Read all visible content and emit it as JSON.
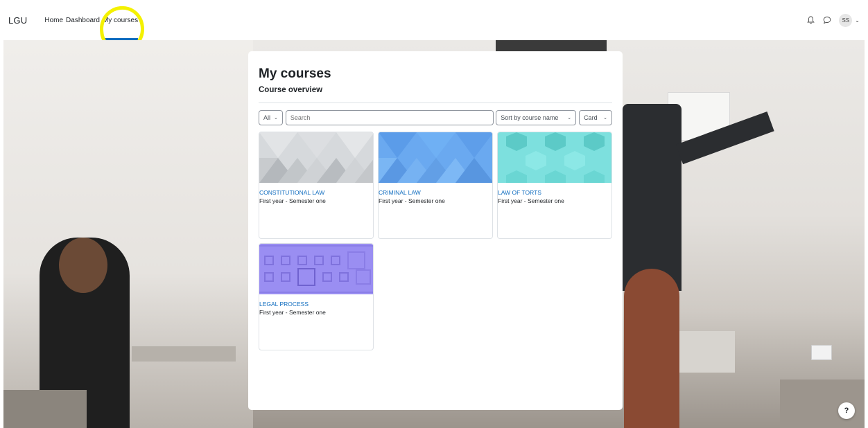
{
  "navbar": {
    "brand": "LGU",
    "links": [
      {
        "label": "Home",
        "active": false
      },
      {
        "label": "Dashboard",
        "active": false
      },
      {
        "label": "My courses",
        "active": true
      }
    ],
    "icons": [
      "bell-icon",
      "chat-bubble-icon"
    ],
    "user_initials": "SS",
    "highlight_color": "#f4f100"
  },
  "main": {
    "page_title": "My courses",
    "block_title": "Course overview",
    "filter": {
      "selected": "All"
    },
    "search": {
      "placeholder": "Search",
      "value": ""
    },
    "sort": {
      "selected": "Sort by course name"
    },
    "view": {
      "selected": "Card"
    },
    "courses": [
      {
        "name": "CONSTITUTIONAL LAW",
        "category": "First year - Semester one",
        "image_color": "#d6d9dc"
      },
      {
        "name": "CRIMINAL LAW",
        "category": "First year - Semester one",
        "image_color": "#6aa9f0"
      },
      {
        "name": "LAW OF TORTS",
        "category": "First year - Semester one",
        "image_color": "#7de0de"
      },
      {
        "name": "LEGAL PROCESS",
        "category": "First year - Semester one",
        "image_color": "#9a8ef2"
      }
    ]
  },
  "help": {
    "label": "?"
  },
  "colors": {
    "accent": "#0f6cbf",
    "text": "#1d2125"
  }
}
